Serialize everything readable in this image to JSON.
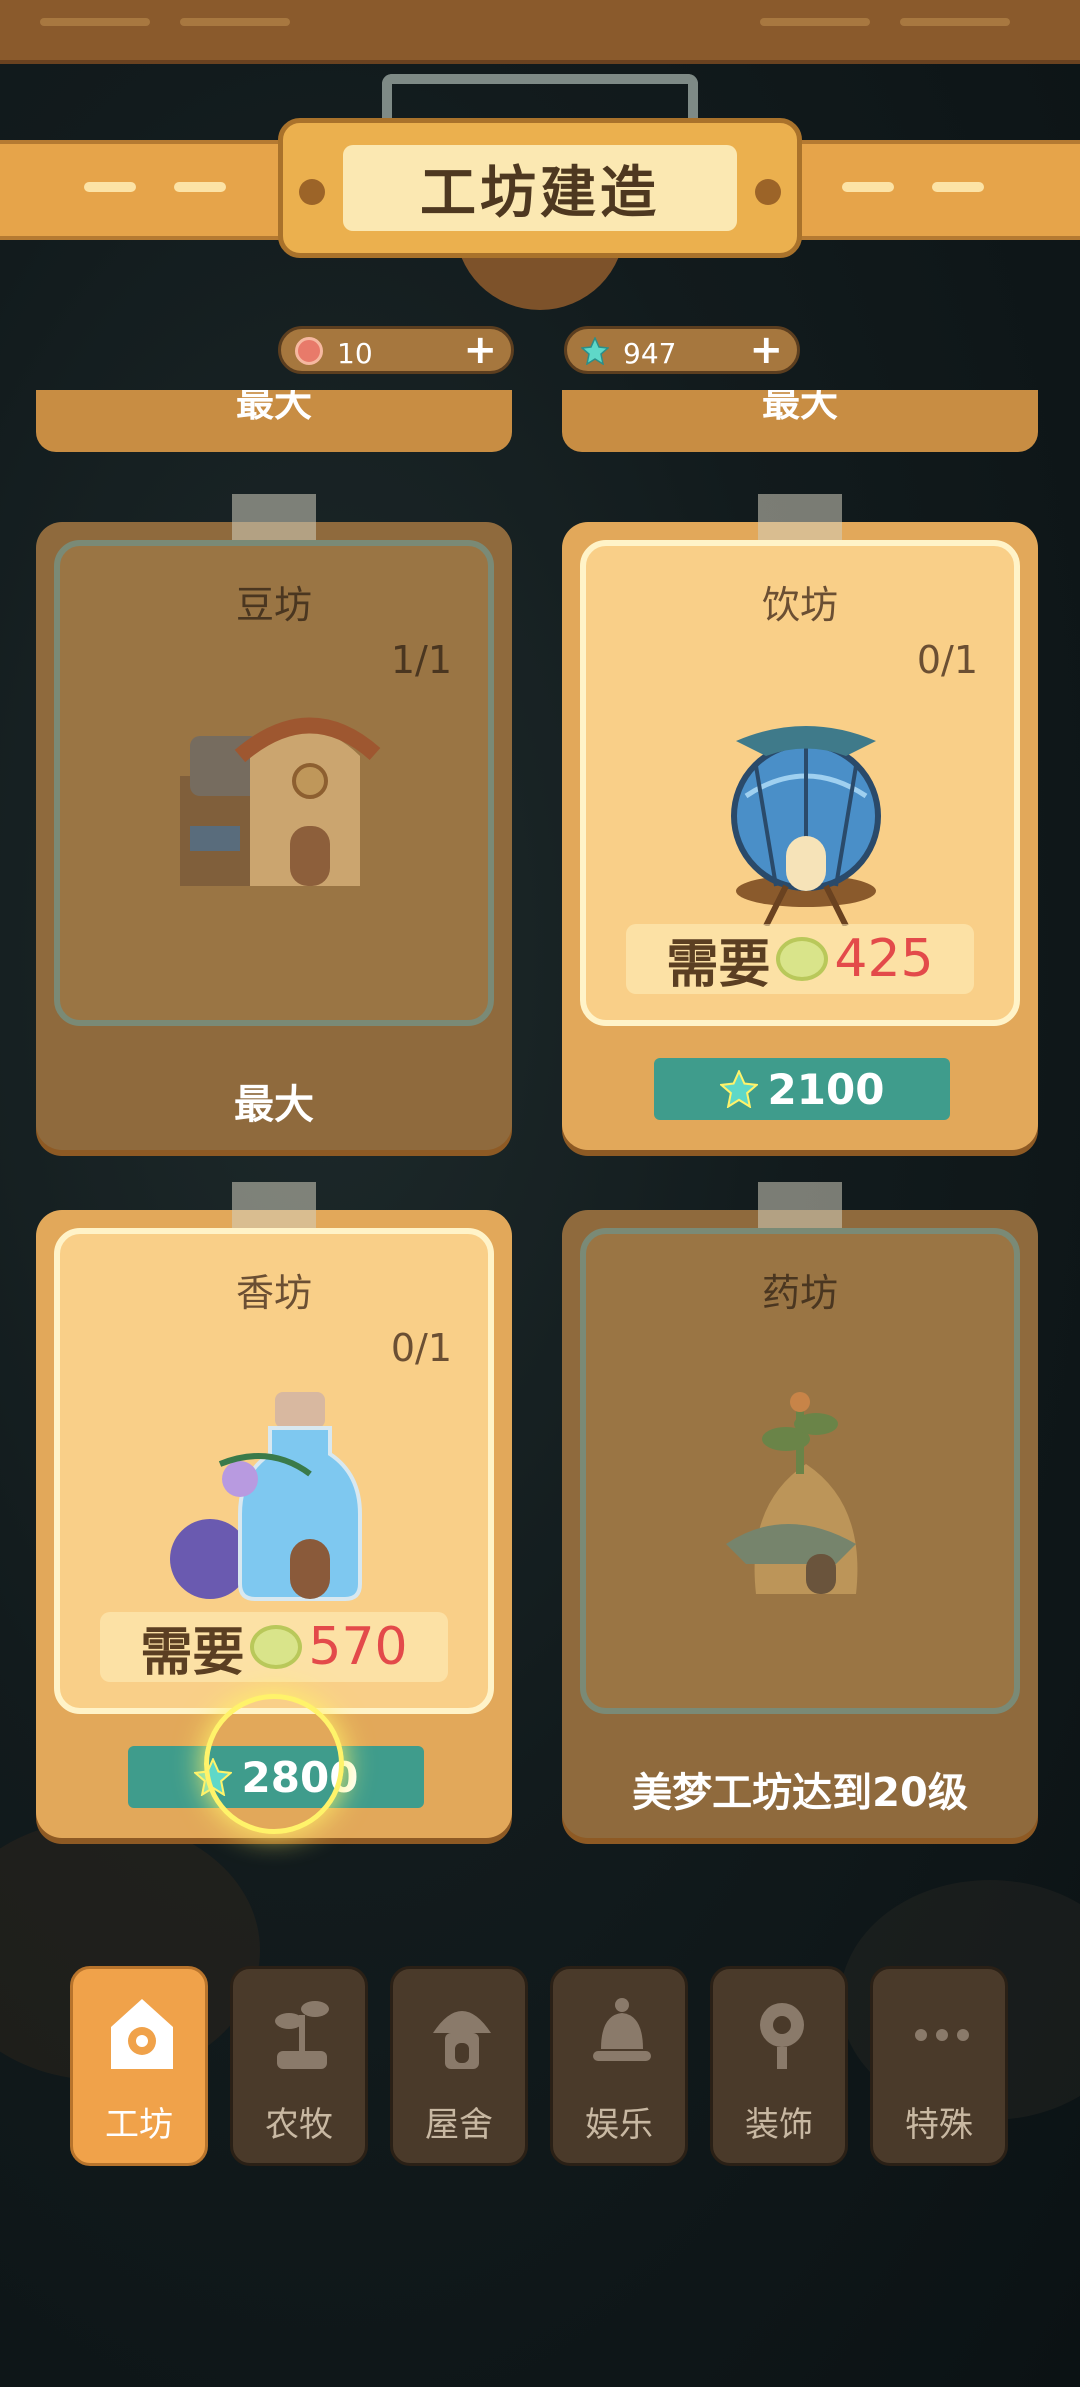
{
  "header": {
    "title": "工坊建造"
  },
  "currencies": [
    {
      "icon": "flower-token-icon",
      "value": "10"
    },
    {
      "icon": "star-gem-icon",
      "value": "947"
    }
  ],
  "partial_cards": [
    {
      "label": "最大"
    },
    {
      "label": "最大"
    }
  ],
  "cards": [
    {
      "name": "豆坊",
      "count": "1/1",
      "footer": "最大",
      "state": "maxed"
    },
    {
      "name": "饮坊",
      "count": "0/1",
      "require_word": "需要",
      "require_amount": "425",
      "price": "2100",
      "state": "available"
    },
    {
      "name": "香坊",
      "count": "0/1",
      "require_word": "需要",
      "require_amount": "570",
      "price": "2800",
      "state": "available"
    },
    {
      "name": "药坊",
      "footer": "美梦工坊达到20级",
      "state": "locked"
    }
  ],
  "tabs": [
    {
      "label": "工坊",
      "icon": "gear-house-icon",
      "active": true
    },
    {
      "label": "农牧",
      "icon": "sprout-icon",
      "active": false
    },
    {
      "label": "屋舍",
      "icon": "mushroom-house-icon",
      "active": false
    },
    {
      "label": "娱乐",
      "icon": "bell-icon",
      "active": false
    },
    {
      "label": "装饰",
      "icon": "lantern-icon",
      "active": false
    },
    {
      "label": "特殊",
      "icon": "more-icon",
      "active": false
    }
  ],
  "colors": {
    "accent": "#f0a24a",
    "price_bg": "#3f9c8c",
    "require_red": "#e34a4a"
  }
}
